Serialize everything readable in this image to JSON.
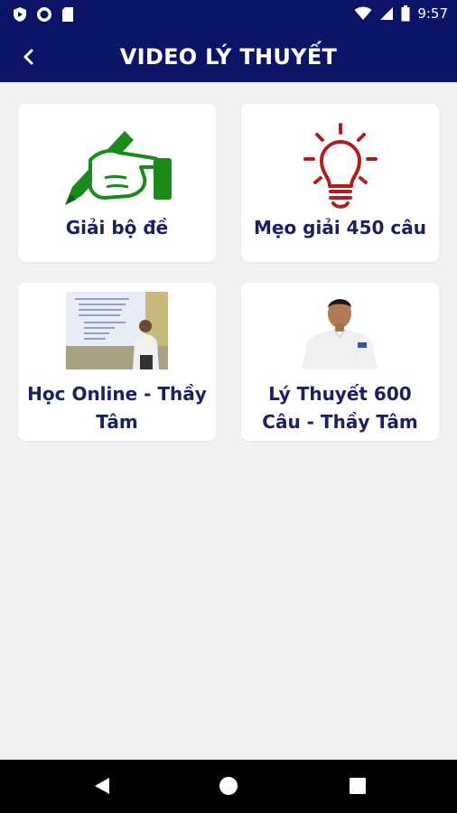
{
  "status_bar": {
    "time": "9:57",
    "left_icons": [
      "shield-play-icon",
      "record-icon",
      "sd-card-icon"
    ],
    "right_icons": [
      "wifi-icon",
      "signal-icon",
      "battery-icon"
    ]
  },
  "app_bar": {
    "title": "VIDEO LÝ THUYẾT",
    "back_icon": "chevron-left-icon"
  },
  "cards": [
    {
      "label": "Giải bộ đề",
      "icon": "pen-in-hand-icon",
      "color": "#1a8a1a"
    },
    {
      "label": "Mẹo giải 450 câu",
      "icon": "lightbulb-icon",
      "color": "#b21e1e"
    },
    {
      "label": "Học Online - Thầy Tâm",
      "image": "lecturer-presentation-photo"
    },
    {
      "label": "Lý Thuyết 600 Câu - Thầy Tâm",
      "image": "lecturer-portrait-photo"
    }
  ],
  "nav_bar": {
    "buttons": [
      "back-triangle-icon",
      "home-circle-icon",
      "recents-square-icon"
    ]
  },
  "colors": {
    "primary": "#0c1468",
    "card_text": "#1b2060",
    "background": "#f1f0f2"
  }
}
